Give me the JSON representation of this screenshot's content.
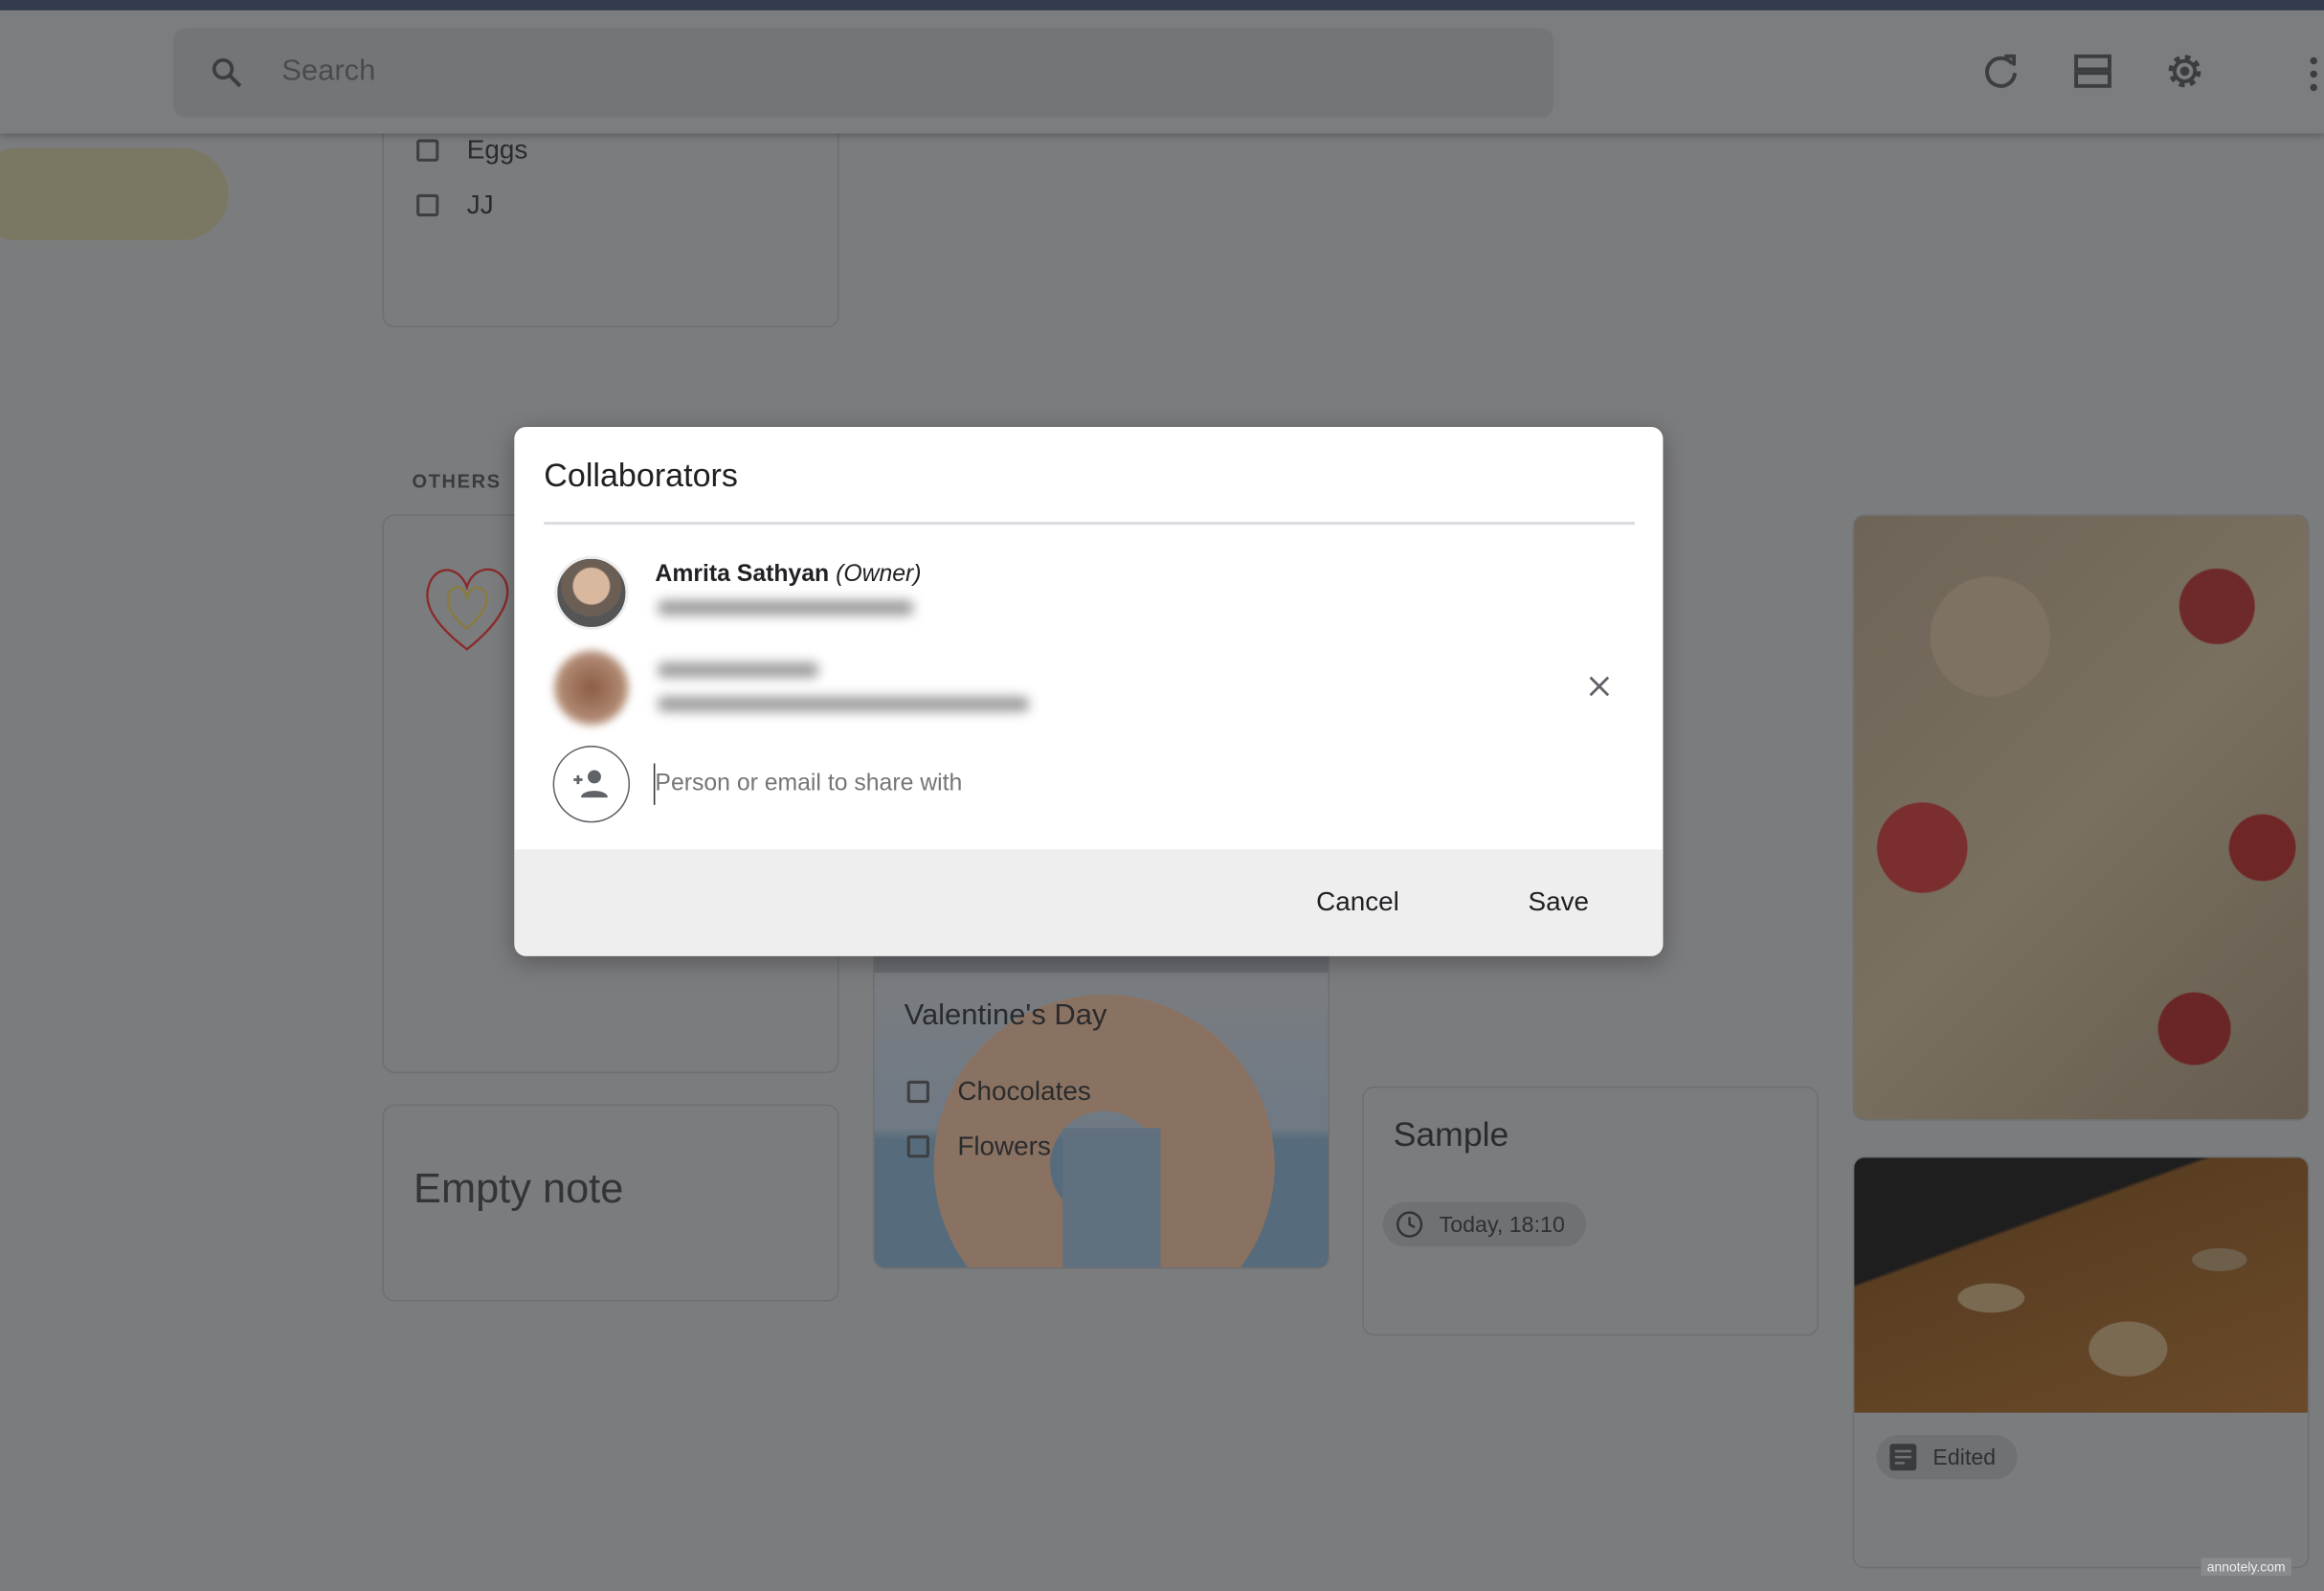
{
  "header": {
    "search_placeholder": "Search",
    "icons": [
      "search-icon",
      "refresh-icon",
      "list-view-icon",
      "settings-icon",
      "more-vert-icon"
    ]
  },
  "notes": {
    "pinned_list": {
      "items": [
        {
          "label": "Eggs",
          "checked": false
        },
        {
          "label": "JJ",
          "checked": false
        }
      ]
    },
    "section_label": "OTHERS",
    "empty_note": {
      "title": "Empty note"
    },
    "valentine": {
      "title": "Valentine's Day",
      "items": [
        {
          "label": "Chocolates",
          "checked": false
        },
        {
          "label": "Flowers",
          "checked": false
        }
      ]
    },
    "sample": {
      "title": "Sample",
      "reminder": "Today, 18:10"
    },
    "food": {
      "chip": "Edited"
    }
  },
  "dialog": {
    "title": "Collaborators",
    "owner": {
      "name": "Amrita Sathyan",
      "role": "(Owner)"
    },
    "input_placeholder": "Person or email to share with",
    "cancel_label": "Cancel",
    "save_label": "Save"
  },
  "watermark": "annotely.com",
  "colors": {
    "overlay": "#7b7c7e",
    "topbar": "#333d4f",
    "dialog_footer": "#eeeeee"
  }
}
